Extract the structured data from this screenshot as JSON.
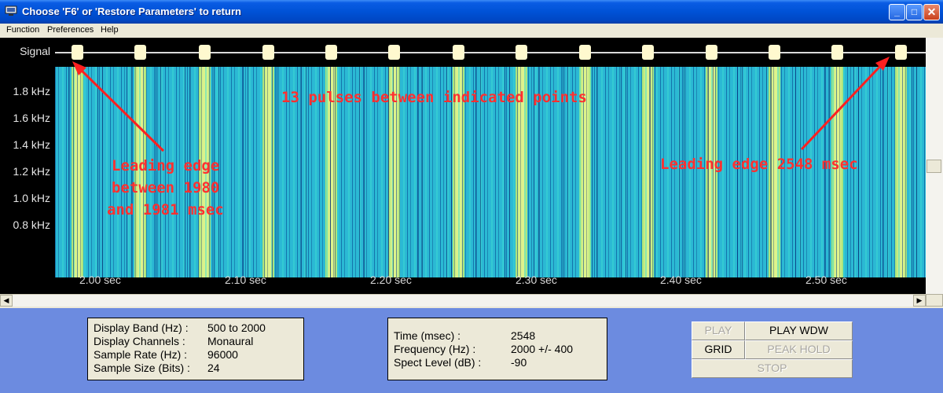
{
  "window": {
    "title": "Choose 'F6' or 'Restore Parameters' to return"
  },
  "menu": [
    "Function",
    "Preferences",
    "Help"
  ],
  "display": {
    "signal_label": "Signal",
    "y_labels": [
      "1.8 kHz",
      "1.6 kHz",
      "1.4 kHz",
      "1.2 kHz",
      "1.0 kHz",
      "0.8 kHz"
    ],
    "x_labels": [
      "2.00 sec",
      "2.10 sec",
      "2.20 sec",
      "2.30 sec",
      "2.40 sec",
      "2.50 sec"
    ],
    "annotations": {
      "center": "13 pulses between indicated points",
      "left": [
        "Leading edge",
        "between 1980",
        "and 1981 msec"
      ],
      "right": "Leading edge 2548 msec"
    },
    "pulse_times_msec": [
      1980.5,
      2024,
      2068,
      2112,
      2155.5,
      2199,
      2243,
      2286.5,
      2330.5,
      2374,
      2417.5,
      2461,
      2504.5,
      2548
    ],
    "colors": {
      "spectrum": "#2bb9d4",
      "pulse": "#d9f28a",
      "annotation": "#ff3030",
      "signal_blob": "#fff9cf"
    }
  },
  "info_left": [
    {
      "label": "Display Band (Hz) :",
      "value": "500 to 2000"
    },
    {
      "label": "Display Channels :",
      "value": "Monaural"
    },
    {
      "label": "Sample Rate (Hz) :",
      "value": "96000"
    },
    {
      "label": "Sample Size (Bits) :",
      "value": "24"
    }
  ],
  "info_right": [
    {
      "label": "Time (msec) :",
      "value": "2548"
    },
    {
      "label": "Frequency (Hz) :",
      "value": "2000 +/- 400"
    },
    {
      "label": "Spect Level (dB) :",
      "value": "-90"
    }
  ],
  "buttons": {
    "play": "PLAY",
    "play_wdw": "PLAY WDW",
    "grid": "GRID",
    "peak_hold": "PEAK HOLD",
    "stop": "STOP"
  }
}
